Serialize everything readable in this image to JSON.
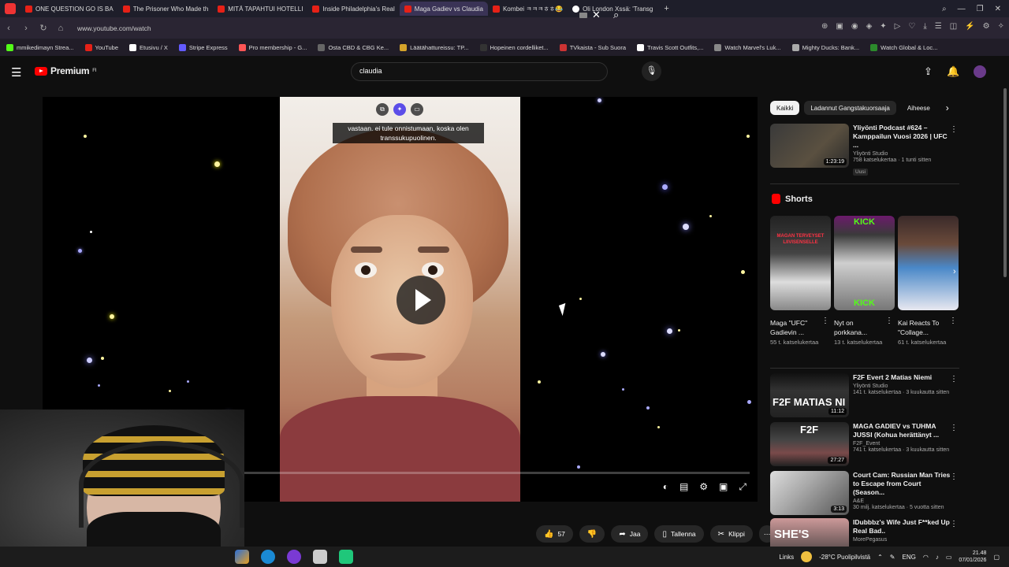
{
  "browser": {
    "tabs": [
      {
        "label": "ONE QUESTION GO IS BA",
        "active": false
      },
      {
        "label": "The Prisoner Who Made th",
        "active": false
      },
      {
        "label": "MITÄ TAPAHTUI HOTELLI",
        "active": false
      },
      {
        "label": "Inside Philadelphia's Real",
        "active": false
      },
      {
        "label": "Maga Gadiev vs Claudia",
        "active": true
      },
      {
        "label": "Kombei ㅋㅋㅋㅎㅎ😂",
        "active": false
      },
      {
        "label": "Oli London Xssä: 'Transg",
        "active": false
      }
    ],
    "url": "www.youtube.com/watch",
    "bookmarks": [
      "mmikedimayn Strea...",
      "YouTube",
      "Etusivu / X",
      "Stripe Express",
      "Pro membership - G...",
      "Osta CBD & CBG Ke...",
      "Läätähattureissu: TP...",
      "Hopeinen cordelliket...",
      "TVkaista - Sub Suora",
      "Travis Scott Outfits,...",
      "Watch Marvel's Luk...",
      "Mighty Ducks: Bank...",
      "Watch Global & Loc..."
    ]
  },
  "header": {
    "logo_text": "Premium",
    "logo_sup": "FI",
    "search_value": "claudia"
  },
  "player": {
    "caption": "vastaan. ei tule onnistumaan, koska olen transsukupuolinen.",
    "progress": 0.04
  },
  "actions": {
    "likes": "57",
    "share": "Jaa",
    "save": "Tallenna",
    "clip": "Klippi"
  },
  "sidebar": {
    "chips": [
      "Kaikki",
      "Ladannut Gangstakuorsaaja",
      "Aiheese"
    ],
    "top_rec": {
      "title": "Yliyönti Podcast #624 – Kamppailun Vuosi 2026 | UFC ...",
      "channel": "Yliyönti Studio",
      "stats": "758 katselukertaa · 1 tunti sitten",
      "badge": "Uusi",
      "duration": "1:23:19"
    },
    "shorts_title": "Shorts",
    "shorts": [
      {
        "title": "Maga \"UFC\" Gadievin ...",
        "views": "55 t. katselukertaa",
        "thumb_text": "MAGAN TERVEYSET LIIVISENSELLE"
      },
      {
        "title": "Nyt on porkkana...",
        "views": "13 t. katselukertaa",
        "thumb_text": "KICK"
      },
      {
        "title": "Kai Reacts To \"Collage...",
        "views": "61 t. katselukertaa",
        "thumb_text": ""
      }
    ],
    "recs": [
      {
        "title": "F2F Evert 2 Matias Niemi",
        "channel": "Yliyönti Studio",
        "stats": "141 t. katselukertaa · 3 kuukautta sitten",
        "duration": "11:12",
        "thumb_text": "F2F MATIAS NI"
      },
      {
        "title": "MAGA GADIEV vs TUHMA JUSSI (Kohua herättänyt ...",
        "channel": "F2F_Event",
        "stats": "741 t. katselukertaa · 3 kuukautta sitten",
        "duration": "27:27",
        "thumb_text": "F2F"
      },
      {
        "title": "Court Cam: Russian Man Tries to Escape from Court (Season...",
        "channel": "A&E",
        "stats": "30 milj. katselukertaa · 5 vuotta sitten",
        "duration": "3:13",
        "thumb_text": ""
      },
      {
        "title": "IDubbbz's Wife Just F**ked Up Real Bad..",
        "channel": "MorePegasus",
        "stats": "",
        "duration": "",
        "thumb_text": "SHE'S"
      }
    ]
  },
  "taskbar": {
    "links": "Links",
    "weather": "-28°C Puolipilvistä",
    "lang": "ENG",
    "time": "21.48",
    "date": "07/01/2026"
  }
}
